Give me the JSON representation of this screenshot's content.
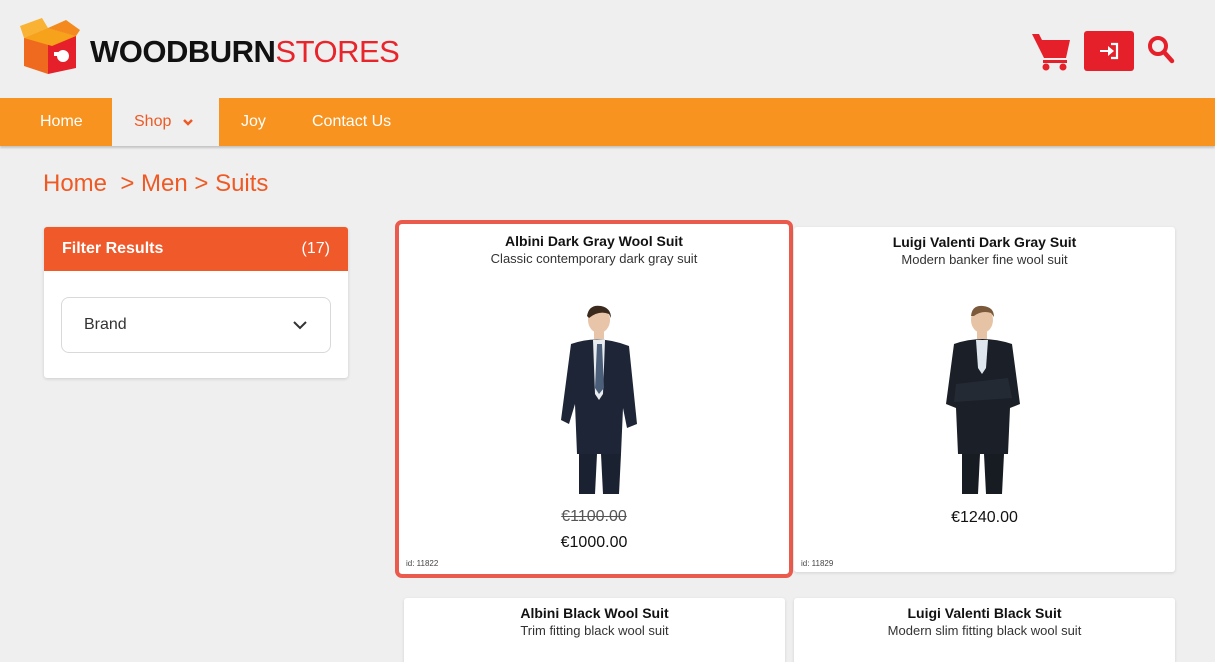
{
  "brand": {
    "name_bold": "WOODBURN",
    "name_light": "STORES"
  },
  "header": {
    "cart_icon": "shopping-cart-icon",
    "login_icon": "sign-in-icon",
    "search_icon": "search-icon"
  },
  "nav": {
    "items": [
      {
        "label": "Home"
      },
      {
        "label": "Shop"
      },
      {
        "label": "Joy"
      },
      {
        "label": "Contact Us"
      }
    ]
  },
  "breadcrumb": "Home  > Men > Suits",
  "filter": {
    "title": "Filter Results",
    "count": "(17)",
    "brand_label": "Brand"
  },
  "products": [
    {
      "title": "Albini Dark Gray Wool Suit",
      "subtitle": "Classic contemporary dark gray suit",
      "old_price": "€1100.00",
      "price": "€1000.00",
      "id": "id: 11822"
    },
    {
      "title": "Luigi Valenti Dark Gray Suit",
      "subtitle": "Modern banker fine wool suit",
      "price": "€1240.00",
      "id": "id: 11829"
    },
    {
      "title": "Albini Black Wool Suit",
      "subtitle": "Trim fitting black wool suit"
    },
    {
      "title": "Luigi Valenti Black Suit",
      "subtitle": "Modern slim fitting black wool suit"
    }
  ],
  "colors": {
    "orange_nav": "#f7931e",
    "orange_accent": "#ef5a24",
    "red_button": "#e5202a",
    "highlight": "#ea5a4d"
  }
}
